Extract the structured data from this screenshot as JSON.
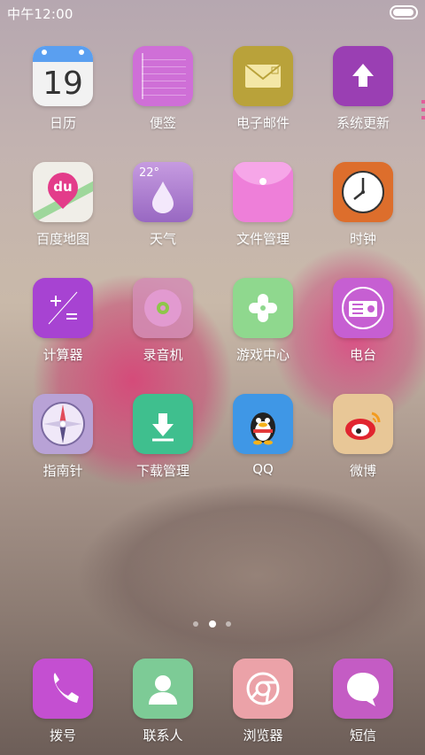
{
  "status": {
    "time": "中午12:00",
    "battery_level": 0.95
  },
  "calendar_day": "19",
  "apps": [
    {
      "label": "日历"
    },
    {
      "label": "便签"
    },
    {
      "label": "电子邮件"
    },
    {
      "label": "系统更新"
    },
    {
      "label": "百度地图"
    },
    {
      "label": "天气"
    },
    {
      "label": "文件管理"
    },
    {
      "label": "时钟"
    },
    {
      "label": "计算器"
    },
    {
      "label": "录音机"
    },
    {
      "label": "游戏中心"
    },
    {
      "label": "电台"
    },
    {
      "label": "指南针"
    },
    {
      "label": "下载管理"
    },
    {
      "label": "QQ"
    },
    {
      "label": "微博"
    }
  ],
  "map_badge": "du",
  "weather_temp": "22°",
  "pager": {
    "pages": 3,
    "current": 2
  },
  "dock": [
    {
      "label": "拨号"
    },
    {
      "label": "联系人"
    },
    {
      "label": "浏览器"
    },
    {
      "label": "短信"
    }
  ]
}
